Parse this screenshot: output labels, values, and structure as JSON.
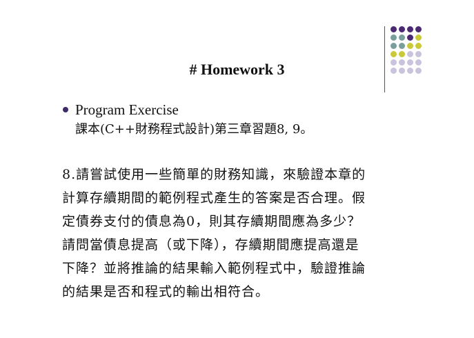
{
  "slide": {
    "title": "# Homework 3",
    "bullet": "Program Exercise",
    "subtext": "課本(C++財務程式設計)第三章習題8, 9。",
    "paragraph_lines": [
      "8.請嘗試使用一些簡單的財務知識，來驗證本章的",
      "計算存續期間的範例程式產生的答案是否合理。假",
      "定債券支付的債息為0，則其存續期間應為多少？",
      "請問當債息提高（或下降），存續期間應提高還是",
      "下降？並將推論的結果輸入範例程式中，驗證推論",
      "的結果是否和程式的輸出相符合。"
    ]
  },
  "decoration": {
    "dot_colors": {
      "purple": "#4b2a73",
      "teal": "#7a9e9b",
      "olive": "#c9c93a",
      "lavender": "#c9c3dd"
    },
    "dot_grid": [
      [
        "purple",
        "purple",
        "purple",
        "purple"
      ],
      [
        "teal",
        "teal",
        "purple",
        "olive"
      ],
      [
        "teal",
        "teal",
        "olive",
        "olive"
      ],
      [
        "olive",
        "olive",
        "lavender",
        "lavender"
      ],
      [
        "lavender",
        "lavender",
        "lavender",
        "lavender"
      ],
      [
        "lavender",
        "lavender",
        "lavender",
        "lavender"
      ]
    ]
  }
}
